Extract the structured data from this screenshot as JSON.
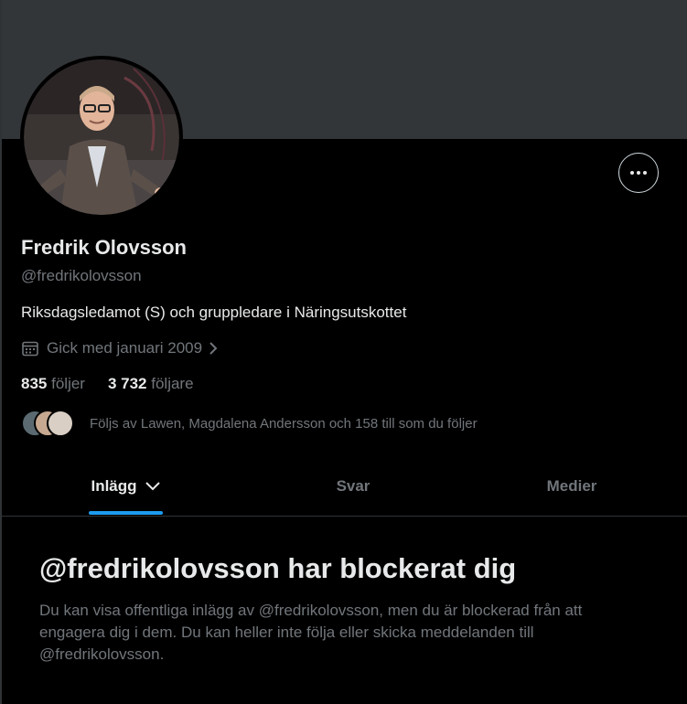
{
  "profile": {
    "name": "Fredrik Olovsson",
    "handle": "@fredrikolovsson",
    "bio": "Riksdagsledamot (S) och gruppledare i Näringsutskottet",
    "joined": "Gick med januari 2009",
    "following_count": "835",
    "following_label": "följer",
    "followers_count": "3 732",
    "followers_label": "följare",
    "followed_by": "Följs av Lawen, Magdalena Andersson och 158 till som du följer"
  },
  "tabs": [
    {
      "label": "Inlägg",
      "active": true
    },
    {
      "label": "Svar",
      "active": false
    },
    {
      "label": "Medier",
      "active": false
    }
  ],
  "blocked": {
    "title": "@fredrikolovsson har blockerat dig",
    "description": "Du kan visa offentliga inlägg av @fredrikolovsson, men du är blockerad från att engagera dig i dem. Du kan heller inte följa eller skicka meddelanden till @fredrikolovsson."
  },
  "colors": {
    "background": "#000000",
    "banner": "#333639",
    "accent": "#1d9bf0",
    "secondary_text": "#71767b",
    "primary_text": "#e7e9ea"
  },
  "icons": {
    "more": "more-horizontal-icon",
    "calendar": "calendar-icon",
    "chevron": "chevron-right-icon",
    "tab_dropdown": "chevron-down-icon"
  }
}
